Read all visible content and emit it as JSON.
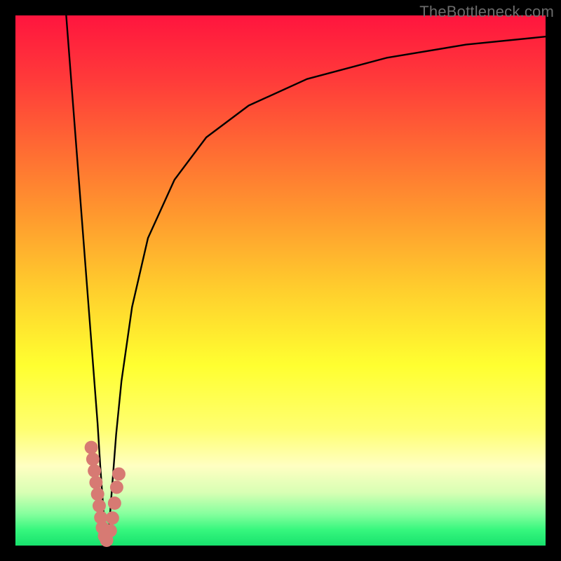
{
  "watermark": "TheBottleneck.com",
  "colors": {
    "curve_stroke": "#000000",
    "marker_fill": "#d77a73",
    "frame": "#000000"
  },
  "chart_data": {
    "type": "line",
    "title": "",
    "xlabel": "",
    "ylabel": "",
    "xlim": [
      0,
      100
    ],
    "ylim": [
      0,
      100
    ],
    "grid": false,
    "legend": false,
    "series": [
      {
        "name": "left-branch",
        "x": [
          9.5,
          10.5,
          11.5,
          12.5,
          13.5,
          14.5,
          15.5,
          16.0,
          16.5,
          17.0
        ],
        "y": [
          101,
          88,
          75,
          62,
          49,
          36,
          23,
          15,
          8,
          1
        ]
      },
      {
        "name": "right-branch",
        "x": [
          17.5,
          18,
          19,
          20,
          22,
          25,
          30,
          36,
          44,
          55,
          70,
          85,
          100
        ],
        "y": [
          1,
          8,
          21,
          31,
          45,
          58,
          69,
          77,
          83,
          88,
          92,
          94.5,
          96
        ]
      }
    ],
    "markers": {
      "name": "highlight-dots",
      "points": [
        {
          "x": 14.3,
          "y": 18.5
        },
        {
          "x": 14.6,
          "y": 16.3
        },
        {
          "x": 14.9,
          "y": 14.1
        },
        {
          "x": 15.2,
          "y": 11.9
        },
        {
          "x": 15.5,
          "y": 9.7
        },
        {
          "x": 15.8,
          "y": 7.5
        },
        {
          "x": 16.1,
          "y": 5.3
        },
        {
          "x": 16.4,
          "y": 3.4
        },
        {
          "x": 16.8,
          "y": 1.8
        },
        {
          "x": 17.2,
          "y": 1.0
        },
        {
          "x": 17.9,
          "y": 2.8
        },
        {
          "x": 18.3,
          "y": 5.2
        },
        {
          "x": 18.7,
          "y": 8.0
        },
        {
          "x": 19.1,
          "y": 11.0
        },
        {
          "x": 19.5,
          "y": 13.5
        }
      ]
    }
  }
}
